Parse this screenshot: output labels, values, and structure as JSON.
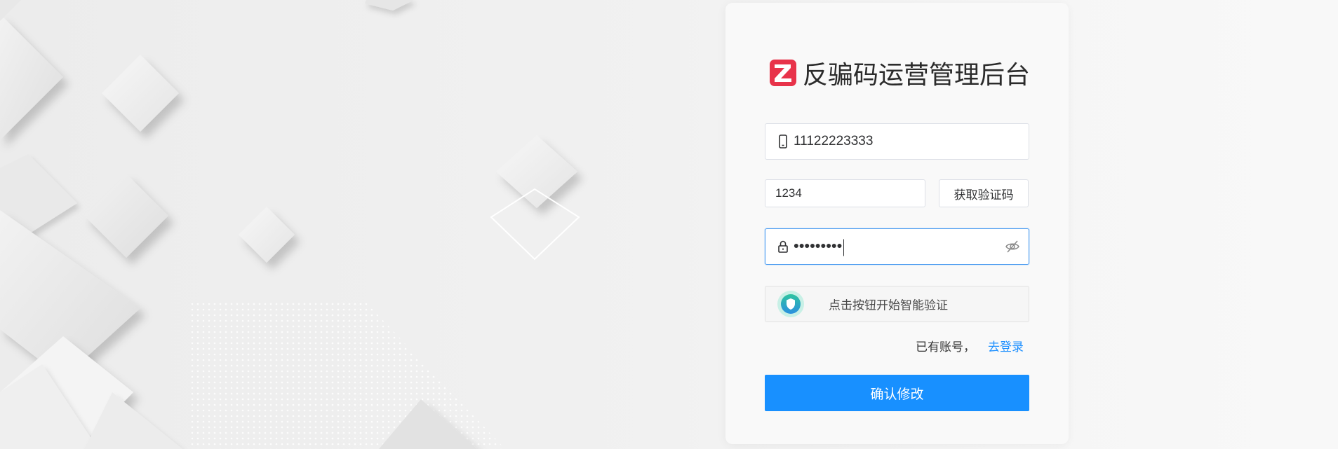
{
  "app": {
    "title": "反骗码运营管理后台",
    "logo_icon": "brand-z-logo-icon",
    "accent_color": "#1890ff",
    "brand_color": "#e8334a"
  },
  "form": {
    "phone": {
      "icon": "mobile-phone-icon",
      "value": "11122223333"
    },
    "code": {
      "value": "1234",
      "get_code_label": "获取验证码"
    },
    "password": {
      "icon": "lock-icon",
      "masked_value": "•••••••••",
      "toggle_icon": "eye-hidden-icon"
    },
    "verify": {
      "icon": "shield-icon",
      "label": "点击按钮开始智能验证"
    },
    "login_prompt": "已有账号，",
    "login_link": "去登录",
    "submit_label": "确认修改"
  }
}
